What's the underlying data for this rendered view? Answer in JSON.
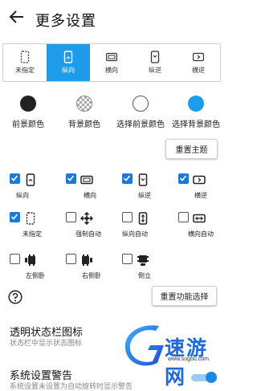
{
  "header": {
    "title": "更多设置"
  },
  "orientation_bar": {
    "options": [
      {
        "label": "未指定",
        "icon": "unspecified-icon",
        "selected": false
      },
      {
        "label": "纵向",
        "icon": "portrait-icon",
        "selected": true
      },
      {
        "label": "横向",
        "icon": "landscape-icon",
        "selected": false
      },
      {
        "label": "纵逆",
        "icon": "reverse-portrait-icon",
        "selected": false
      },
      {
        "label": "横逆",
        "icon": "reverse-landscape-icon",
        "selected": false
      }
    ]
  },
  "colors": {
    "items": [
      {
        "label": "前景颜色",
        "color": "#222222"
      },
      {
        "label": "背景颜色",
        "color": "checkered"
      },
      {
        "label": "选择前景颜色",
        "color": "#ffffff"
      },
      {
        "label": "选择背景颜色",
        "color": "#1e9be9"
      }
    ],
    "reset_label": "重置主题"
  },
  "features": {
    "items": [
      {
        "label": "纵向",
        "checked": true,
        "icon": "portrait-icon"
      },
      {
        "label": "横向",
        "checked": true,
        "icon": "landscape-icon"
      },
      {
        "label": "纵逆",
        "checked": true,
        "icon": "reverse-portrait-icon"
      },
      {
        "label": "横逆",
        "checked": true,
        "icon": "reverse-landscape-icon"
      },
      {
        "label": "未指定",
        "checked": true,
        "icon": "unspecified-icon"
      },
      {
        "label": "强制自动",
        "checked": false,
        "icon": "force-auto-icon"
      },
      {
        "label": "纵向自动",
        "checked": false,
        "icon": "portrait-auto-icon"
      },
      {
        "label": "横向自动",
        "checked": false,
        "icon": "landscape-auto-icon"
      },
      {
        "label": "左侧卧",
        "checked": false,
        "icon": "lie-left-icon"
      },
      {
        "label": "右侧卧",
        "checked": false,
        "icon": "lie-right-icon"
      },
      {
        "label": "倒立",
        "checked": false,
        "icon": "upside-down-icon"
      }
    ],
    "reset_label": "重置功能选择"
  },
  "settings": [
    {
      "title": "透明状态栏图标",
      "desc": "状态栏中显示状态图标"
    },
    {
      "title": "系统设置警告",
      "desc": "系统设置未设置为自动旋转时显示警告",
      "enabled": true
    }
  ],
  "watermark": {
    "text": "速游网",
    "sub": "www.sugou.com"
  }
}
